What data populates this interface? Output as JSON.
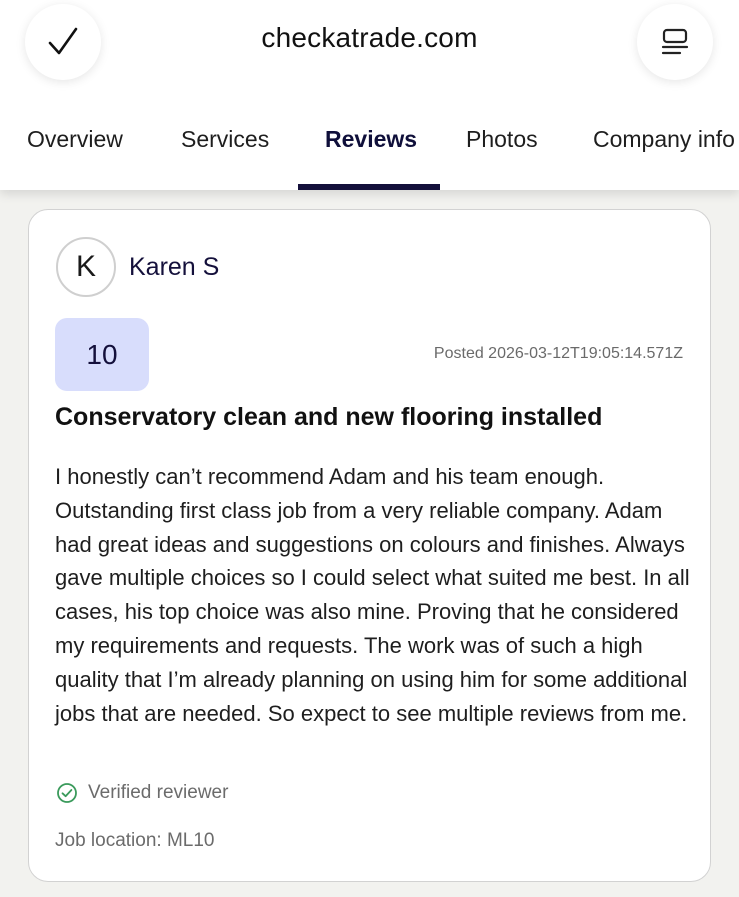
{
  "header": {
    "site_title": "checkatrade.com",
    "left_icon": "checkmark-icon",
    "right_icon": "menu-icon"
  },
  "tabs": [
    {
      "label": "Overview",
      "active": false
    },
    {
      "label": "Services",
      "active": false
    },
    {
      "label": "Reviews",
      "active": true
    },
    {
      "label": "Photos",
      "active": false
    },
    {
      "label": "Company info",
      "active": false
    }
  ],
  "review": {
    "avatar_initial": "K",
    "reviewer_name": "Karen S",
    "score": "10",
    "posted": "Posted 2026-03-12T19:05:14.571Z",
    "title": "Conservatory clean and new flooring installed",
    "body": "I honestly can’t recommend Adam and his team enough. Outstanding first class job from a very reliable company. Adam had great ideas and suggestions on colours and finishes. Always gave multiple choices so I could select what suited me best. In all cases, his top choice was also mine. Proving that he considered my requirements and requests. The work was of such a high quality that I’m already planning on using him for some additional jobs that are needed. So expect to see multiple reviews from me.",
    "verified_label": "Verified reviewer",
    "job_location": "Job location: ML10"
  },
  "colors": {
    "brand_navy": "#14103b",
    "score_bg": "#d8ddfc",
    "verified_green": "#3a9a5b"
  }
}
